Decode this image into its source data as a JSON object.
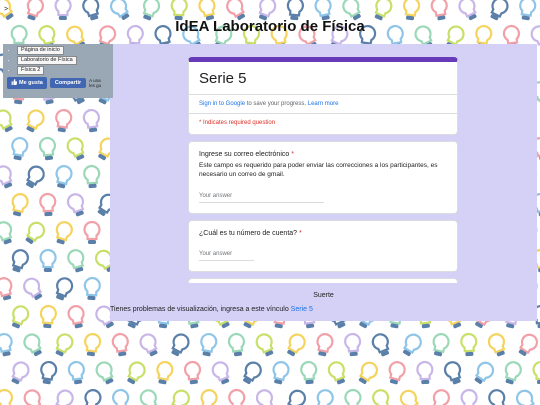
{
  "top_marker": ">",
  "site_title": "IdEA Laboratorio de Física",
  "nav": {
    "items": [
      "Página de inicio",
      "Laboratorio de Física",
      "Física 2"
    ],
    "like_label": "Me gusta",
    "share_label": "Compartir",
    "side_text": "A una les gu"
  },
  "form": {
    "title": "Serie 5",
    "signin_link": "Sign in to Google",
    "signin_text": " to save your progress. ",
    "learn_more": "Learn more",
    "required_note": "* Indicates required question",
    "questions": [
      {
        "title": "Ingrese su correo electrónico",
        "required": "*",
        "description": "Este campo es requerido para poder enviar las correcciones a los participantes, es necesario un correo de gmail.",
        "placeholder": "Your answer"
      },
      {
        "title": "¿Cuál es tu número de cuenta?",
        "required": "*",
        "placeholder": "Your answer"
      }
    ]
  },
  "footer": {
    "suerte": "Suerte",
    "problems_text": "Tienes problemas de visualización, ingresa a este vínculo ",
    "problems_link": "Serie 5"
  },
  "colors": {
    "accent": "#673ab7",
    "panel": "#d4d0f6",
    "link": "#1a73e8",
    "required": "#d93025",
    "facebook": "#4267b2"
  },
  "icons": [
    "lightbulb-icon",
    "thumbs-up-icon"
  ]
}
